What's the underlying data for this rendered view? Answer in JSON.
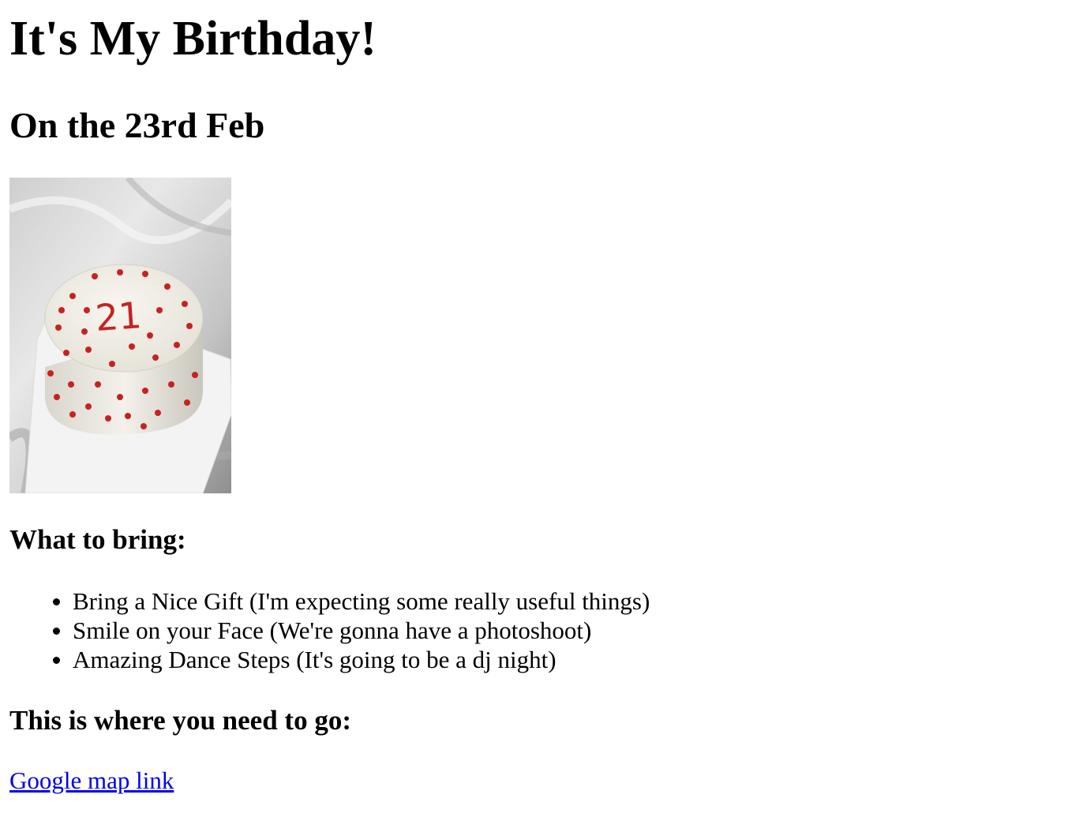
{
  "page": {
    "title": "It's My Birthday!",
    "subtitle": "On the 23rd Feb"
  },
  "photo": {
    "description_icon": "birthday-cake-photo",
    "cake_number": "21",
    "colors": {
      "cloth": "#d9d9d9",
      "frosting": "#f1eee6",
      "hearts": "#c62222",
      "board": "#f3f3f3"
    }
  },
  "bring": {
    "heading": "What to bring:",
    "items": [
      "Bring a Nice Gift (I'm expecting some really useful things)",
      "Smile on your Face (We're gonna have a photoshoot)",
      "Amazing Dance Steps (It's going to be a dj night)"
    ]
  },
  "location": {
    "heading": "This is where you need to go:",
    "link_label": "Google map link",
    "link_color": "#0000ee"
  }
}
